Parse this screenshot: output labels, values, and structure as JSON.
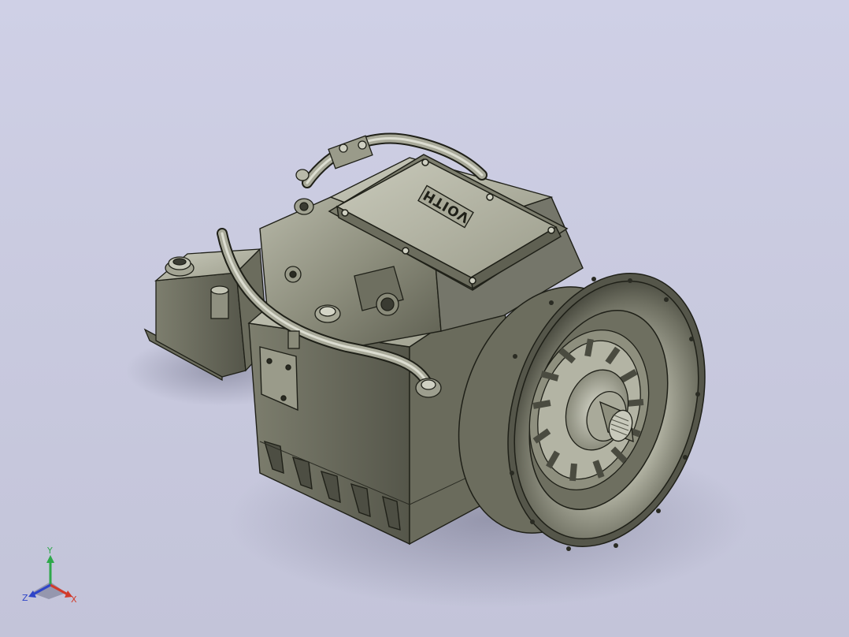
{
  "viewport": {
    "background_top": "#cfd0e6",
    "background_bottom": "#c3c4d9"
  },
  "model": {
    "emblem_text": "VOITH",
    "body_color": "#8a8b7a",
    "edge_color": "#1f2018"
  },
  "triad": {
    "x_label": "X",
    "y_label": "Y",
    "z_label": "Z",
    "x_color": "#d23a2a",
    "y_color": "#2ea84a",
    "z_color": "#2f45c8"
  }
}
